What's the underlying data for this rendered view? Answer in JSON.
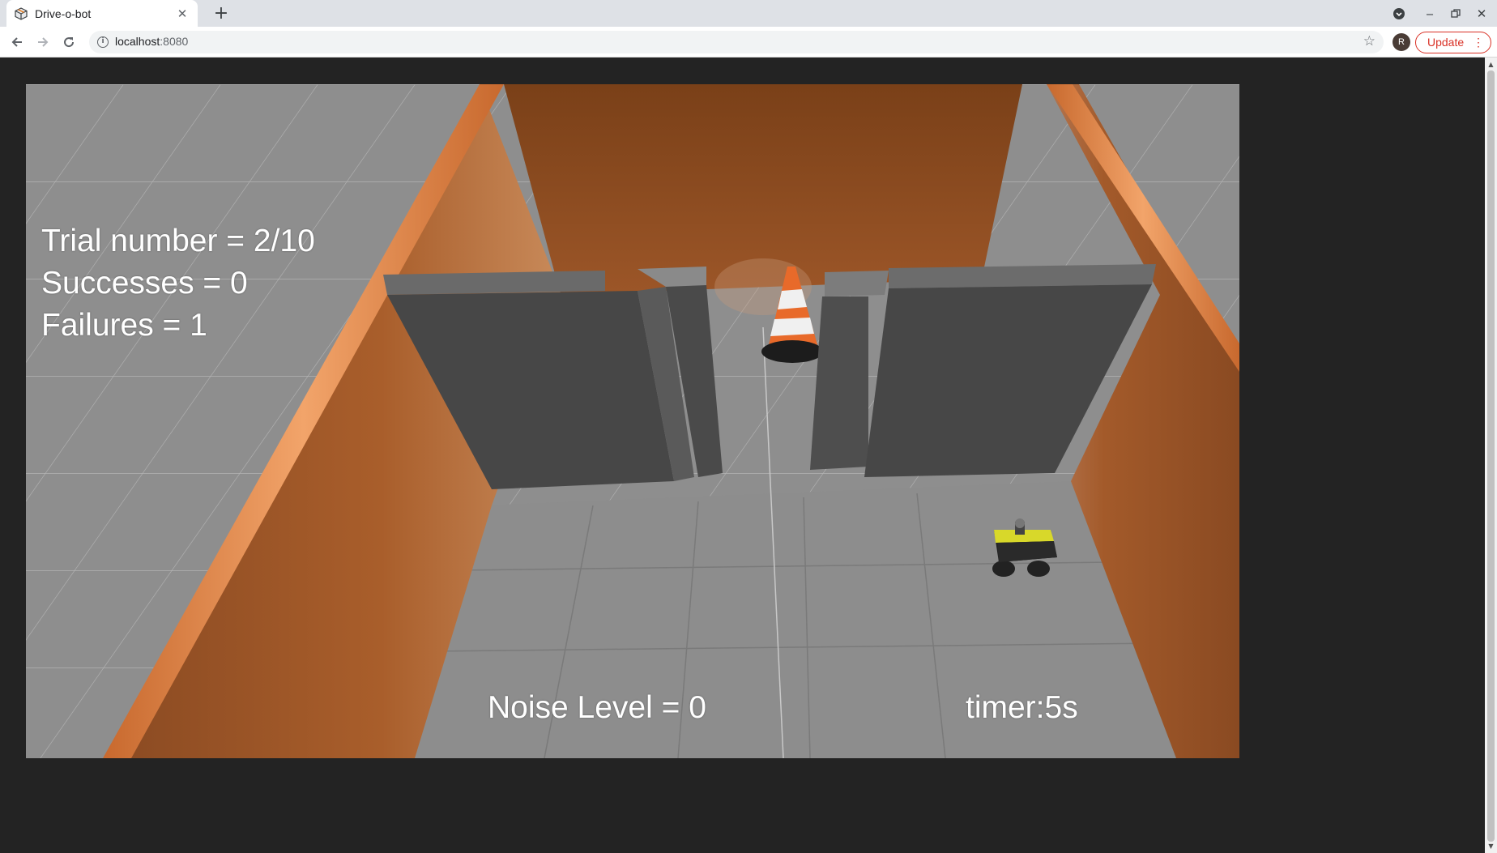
{
  "browser": {
    "tab_title": "Drive-o-bot",
    "url_host": "localhost",
    "url_port": ":8080",
    "avatar_letter": "R",
    "update_label": "Update",
    "icons": [
      "favicon-box-icon",
      "close-icon",
      "plus-icon",
      "tab-search-icon",
      "minimize-icon",
      "restore-icon",
      "window-close-icon",
      "back-arrow-icon",
      "forward-arrow-icon",
      "reload-icon",
      "info-icon",
      "bookmark-star-icon",
      "kebab-menu-icon"
    ]
  },
  "sim": {
    "trial_label": "Trial number = 2/10",
    "successes_label": "Successes = 0",
    "failures_label": "Failures = 1",
    "noise_label": "Noise Level = 0",
    "timer_label": "timer:5s",
    "colors": {
      "floor": "#8f8f8f",
      "wood": "#a85a2a",
      "wall_gray": "#474747",
      "page_bg": "#232323",
      "update_red": "#d93025"
    }
  }
}
